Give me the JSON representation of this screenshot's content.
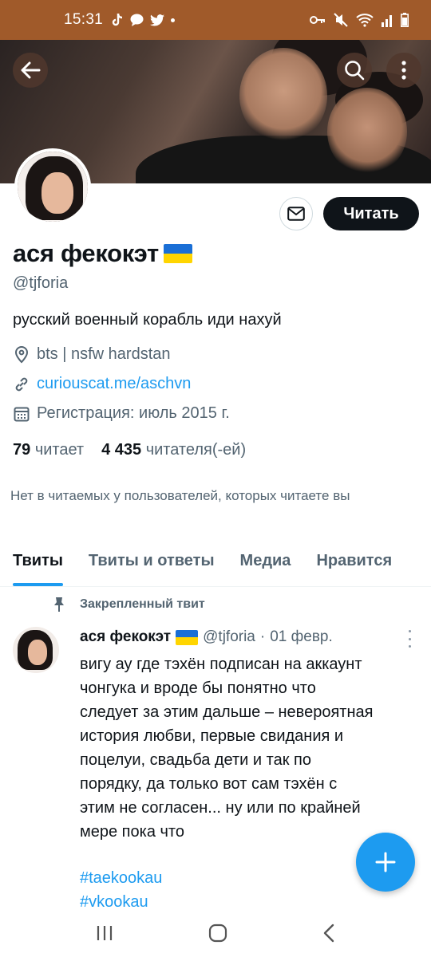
{
  "status_bar": {
    "time": "15:31",
    "left_icons": [
      "tiktok-icon",
      "chat-bubble-icon",
      "twitter-bird-icon",
      "dot-icon"
    ],
    "right_icons": [
      "key-icon",
      "mute-icon",
      "wifi-icon",
      "signal-icon",
      "battery-icon"
    ],
    "color": "#a05a2a"
  },
  "header": {
    "back_icon": "arrow-left-icon",
    "search_icon": "search-icon",
    "more_icon": "more-vertical-icon"
  },
  "profile": {
    "display_name": "ася фекокэт",
    "flag": "ukraine-flag-icon",
    "handle": "@tjforia",
    "bio": "русский военный корабль иди нахуй",
    "location": "bts | nsfw hardstan",
    "link": "curiouscat.me/aschvn",
    "joined": "Регистрация: июль 2015 г.",
    "following_count": "79",
    "following_label": "читает",
    "followers_count": "4 435",
    "followers_label": "читателя(-ей)",
    "followed_by": "Нет в читаемых у пользователей, которых читаете вы",
    "follow_button": "Читать",
    "message_icon": "envelope-icon"
  },
  "tabs": [
    {
      "label": "Твиты",
      "active": true
    },
    {
      "label": "Твиты и ответы",
      "active": false
    },
    {
      "label": "Медиа",
      "active": false
    },
    {
      "label": "Нравится",
      "active": false
    }
  ],
  "pinned_tweet": {
    "pinned_label": "Закрепленный твит",
    "author_name": "ася фекокэт",
    "author_handle": "@tjforia",
    "separator": "·",
    "date": "01 февр.",
    "lines": [
      "вигу ау где тэхён подписан на аккаунт",
      "чонгука и вроде бы понятно что",
      "следует за этим дальше – невероятная",
      "история любви, первые свидания и",
      "поцелуи, свадьба дети и так по",
      "порядку, да только вот сам тэхён с",
      "этим не согласен... ну или по крайней",
      "мере пока что"
    ],
    "hashtags": [
      "#taekookau",
      "#vkookau"
    ]
  },
  "fab": {
    "icon": "plus-icon"
  },
  "nav_bar": {
    "icons": [
      "recent-apps-icon",
      "home-icon",
      "back-nav-icon"
    ]
  }
}
